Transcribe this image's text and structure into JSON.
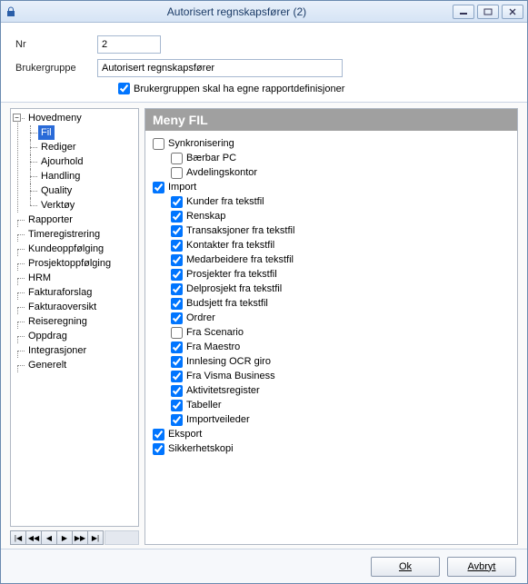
{
  "window": {
    "title": "Autorisert regnskapsfører (2)"
  },
  "form": {
    "nr_label": "Nr",
    "nr_value": "2",
    "group_label": "Brukergruppe",
    "group_value": "Autorisert regnskapsfører",
    "own_reports_label": "Brukergruppen skal ha egne rapportdefinisjoner",
    "own_reports_checked": true
  },
  "tree": {
    "root": "Hovedmeny",
    "children": [
      "Fil",
      "Rediger",
      "Ajourhold",
      "Handling",
      "Quality",
      "Verktøy"
    ],
    "siblings": [
      "Rapporter",
      "Timeregistrering",
      "Kundeoppfølging",
      "Prosjektoppfølging",
      "HRM",
      "Fakturaforslag",
      "Fakturaoversikt",
      "Reiseregning",
      "Oppdrag",
      "Integrasjoner",
      "Generelt"
    ],
    "selected": "Fil"
  },
  "panel": {
    "header": "Meny FIL",
    "items": [
      {
        "indent": 1,
        "label": "Synkronisering",
        "checked": false
      },
      {
        "indent": 2,
        "label": "Bærbar PC",
        "checked": false
      },
      {
        "indent": 2,
        "label": "Avdelingskontor",
        "checked": false
      },
      {
        "indent": 1,
        "label": "Import",
        "checked": true
      },
      {
        "indent": 2,
        "label": "Kunder fra tekstfil",
        "checked": true
      },
      {
        "indent": 2,
        "label": "Renskap",
        "checked": true
      },
      {
        "indent": 2,
        "label": "Transaksjoner fra tekstfil",
        "checked": true
      },
      {
        "indent": 2,
        "label": "Kontakter fra tekstfil",
        "checked": true
      },
      {
        "indent": 2,
        "label": "Medarbeidere fra tekstfil",
        "checked": true
      },
      {
        "indent": 2,
        "label": "Prosjekter fra tekstfil",
        "checked": true
      },
      {
        "indent": 2,
        "label": "Delprosjekt fra tekstfil",
        "checked": true
      },
      {
        "indent": 2,
        "label": "Budsjett fra tekstfil",
        "checked": true
      },
      {
        "indent": 2,
        "label": "Ordrer",
        "checked": true
      },
      {
        "indent": 2,
        "label": "Fra Scenario",
        "checked": false
      },
      {
        "indent": 2,
        "label": "Fra Maestro",
        "checked": true
      },
      {
        "indent": 2,
        "label": "Innlesing OCR giro",
        "checked": true
      },
      {
        "indent": 2,
        "label": "Fra Visma Business",
        "checked": true
      },
      {
        "indent": 2,
        "label": "Aktivitetsregister",
        "checked": true
      },
      {
        "indent": 2,
        "label": "Tabeller",
        "checked": true
      },
      {
        "indent": 2,
        "label": "Importveileder",
        "checked": true
      },
      {
        "indent": 1,
        "label": "Eksport",
        "checked": true
      },
      {
        "indent": 1,
        "label": "Sikkerhetskopi",
        "checked": true
      }
    ]
  },
  "footer": {
    "ok": "Ok",
    "cancel": "Avbryt"
  }
}
